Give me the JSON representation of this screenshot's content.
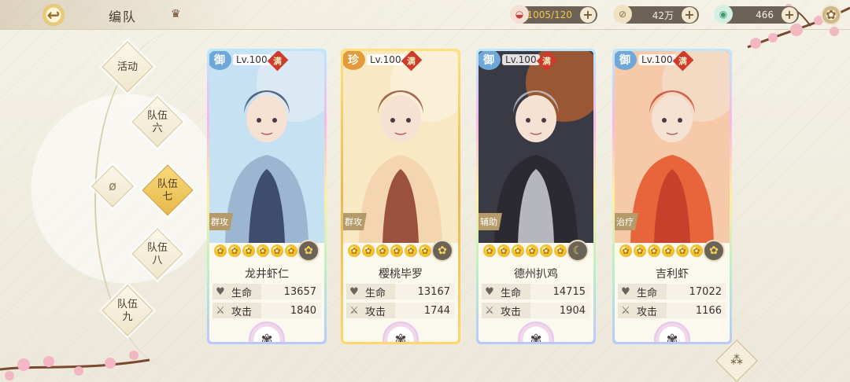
{
  "header": {
    "back_label": "↩",
    "title": "编队",
    "crown_icon": "crown-icon"
  },
  "resources": [
    {
      "name": "stamina",
      "icon": "food-bowl-icon",
      "value": "1005/120"
    },
    {
      "name": "gold",
      "icon": "scroll-coin-icon",
      "value": "42万"
    },
    {
      "name": "gems",
      "icon": "jade-icon",
      "value": "466"
    }
  ],
  "side_nav": [
    {
      "label": "活动",
      "active": false
    },
    {
      "label": "队伍六",
      "line1": "队伍",
      "line2": "六",
      "active": false
    },
    {
      "label": "队伍七",
      "line1": "队伍",
      "line2": "七",
      "active": true
    },
    {
      "label": "队伍八",
      "line1": "队伍",
      "line2": "八",
      "active": false
    },
    {
      "label": "队伍九",
      "line1": "队伍",
      "line2": "九",
      "active": false
    }
  ],
  "filter_icon": "ø",
  "cards": [
    {
      "grade": "御",
      "grade_color": "#6fa8d8",
      "level": "Lv.100",
      "maxed": "满",
      "role": "群攻",
      "stars": 6,
      "element_icon": "flower-icon",
      "name": "龙井虾仁",
      "hp_label": "生命",
      "hp": "13657",
      "atk_label": "攻击",
      "atk": "1840",
      "frame": "rainbow",
      "palette": [
        "#c6e2f2",
        "#9cb6d2",
        "#e9eef6",
        "#2e3b5b"
      ]
    },
    {
      "grade": "珍",
      "grade_color": "#e39a3a",
      "level": "Lv.100",
      "maxed": "满",
      "role": "群攻",
      "stars": 6,
      "element_icon": "flower-icon",
      "name": "樱桃毕罗",
      "hp_label": "生命",
      "hp": "13167",
      "atk_label": "攻击",
      "atk": "1744",
      "frame": "gold",
      "palette": [
        "#f8e9c4",
        "#f3d6b0",
        "#fbf4e4",
        "#8a3a2a"
      ]
    },
    {
      "grade": "御",
      "grade_color": "#6fa8d8",
      "level": "Lv.100",
      "maxed": "满",
      "role": "辅助",
      "stars": 6,
      "element_icon": "moon-icon",
      "name": "德州扒鸡",
      "hp_label": "生命",
      "hp": "14715",
      "atk_label": "攻击",
      "atk": "1904",
      "frame": "rainbow",
      "palette": [
        "#3a3a44",
        "#2a2a30",
        "#d96a2a",
        "#cfcfd6"
      ]
    },
    {
      "grade": "御",
      "grade_color": "#6fa8d8",
      "level": "Lv.100",
      "maxed": "满",
      "role": "治疗",
      "stars": 6,
      "element_icon": "flower-icon",
      "name": "吉利虾",
      "hp_label": "生命",
      "hp": "17022",
      "atk_label": "攻击",
      "atk": "1166",
      "frame": "rainbow",
      "palette": [
        "#f6c9a8",
        "#e8643a",
        "#f4e4d6",
        "#c2382a"
      ]
    }
  ],
  "share_icon": "⁂"
}
